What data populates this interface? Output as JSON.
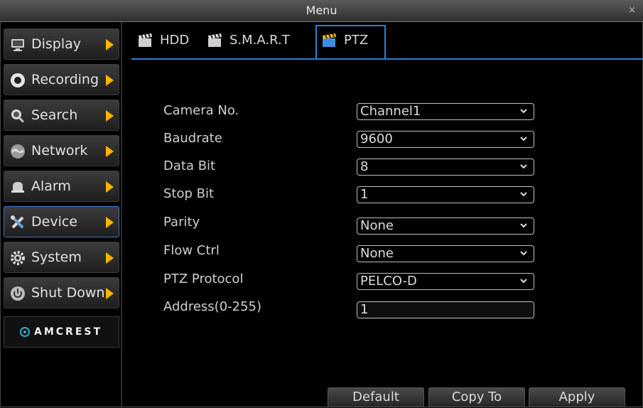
{
  "window": {
    "title": "Menu",
    "close_glyph": "×"
  },
  "sidebar": {
    "items": [
      {
        "label": "Display",
        "icon": "monitor-icon"
      },
      {
        "label": "Recording",
        "icon": "record-icon"
      },
      {
        "label": "Search",
        "icon": "magnifier-icon"
      },
      {
        "label": "Network",
        "icon": "globe-icon"
      },
      {
        "label": "Alarm",
        "icon": "alarm-bell-icon"
      },
      {
        "label": "Device",
        "icon": "tools-icon",
        "active": true
      },
      {
        "label": "System",
        "icon": "gear-icon"
      },
      {
        "label": "Shut Down",
        "icon": "power-icon"
      }
    ],
    "logo_text": "AMCREST"
  },
  "tabs": [
    {
      "label": "HDD"
    },
    {
      "label": "S.M.A.R.T"
    },
    {
      "label": "PTZ",
      "active": true
    }
  ],
  "form": {
    "camera_no": {
      "label": "Camera No.",
      "value": "Channel1"
    },
    "baudrate": {
      "label": "Baudrate",
      "value": "9600"
    },
    "data_bit": {
      "label": "Data Bit",
      "value": "8"
    },
    "stop_bit": {
      "label": "Stop Bit",
      "value": "1"
    },
    "parity": {
      "label": "Parity",
      "value": "None"
    },
    "flow_ctrl": {
      "label": "Flow Ctrl",
      "value": "None"
    },
    "ptz_protocol": {
      "label": "PTZ Protocol",
      "value": "PELCO-D"
    },
    "address": {
      "label": "Address(0-255)",
      "value": "1"
    }
  },
  "buttons": {
    "default": "Default",
    "copy_to": "Copy To",
    "apply": "Apply"
  },
  "colors": {
    "accent": "#2e7fd0",
    "arrow": "#ffb300"
  }
}
